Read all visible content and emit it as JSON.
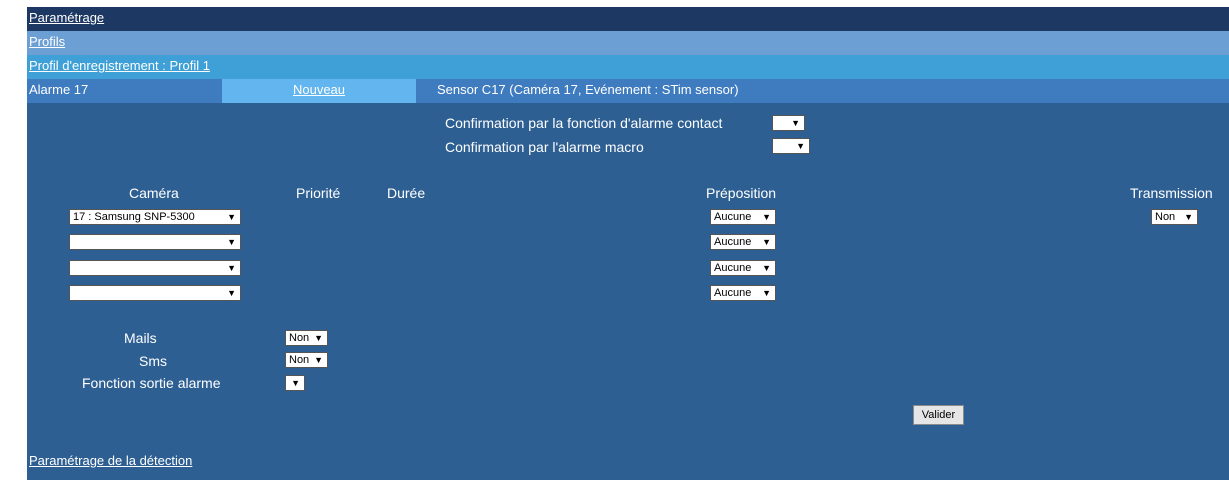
{
  "nav": {
    "parametrage": "Paramétrage",
    "profils": "Profils",
    "profil_enregistrement": "Profil d'enregistrement : Profil 1"
  },
  "alarm_bar": {
    "alarm_label": "Alarme 17",
    "nouveau": "Nouveau",
    "sensor": "Sensor C17  (Caméra 17, Evénement : STim sensor)"
  },
  "confirmations": {
    "contact_label": "Confirmation par la fonction d'alarme contact",
    "contact_value": "",
    "macro_label": "Confirmation par l'alarme macro",
    "macro_value": ""
  },
  "table": {
    "headers": {
      "camera": "Caméra",
      "priorite": "Priorité",
      "duree": "Durée",
      "preposition": "Préposition",
      "transmission": "Transmission"
    },
    "rows": [
      {
        "camera": "17 : Samsung SNP-5300",
        "preposition": "Aucune"
      },
      {
        "camera": "",
        "preposition": "Aucune"
      },
      {
        "camera": "",
        "preposition": "Aucune"
      },
      {
        "camera": "",
        "preposition": "Aucune"
      }
    ],
    "transmission_value": "Non"
  },
  "notifications": {
    "mails_label": "Mails",
    "mails_value": "Non",
    "sms_label": "Sms",
    "sms_value": "Non",
    "sortie_label": "Fonction sortie alarme",
    "sortie_value": ""
  },
  "actions": {
    "valider": "Valider"
  },
  "footer": {
    "detection_link": "Paramétrage de la détection"
  },
  "icons": {
    "dropdown_arrow": "▼"
  },
  "colors": {
    "header_dark": "#1d3963",
    "profils_bar": "#6c9fd3",
    "profil_bar": "#3ea0d6",
    "alarm_bar": "#3f7bbf",
    "nouveau_tab": "#62b5ee",
    "panel_bg": "#2d5f93"
  }
}
